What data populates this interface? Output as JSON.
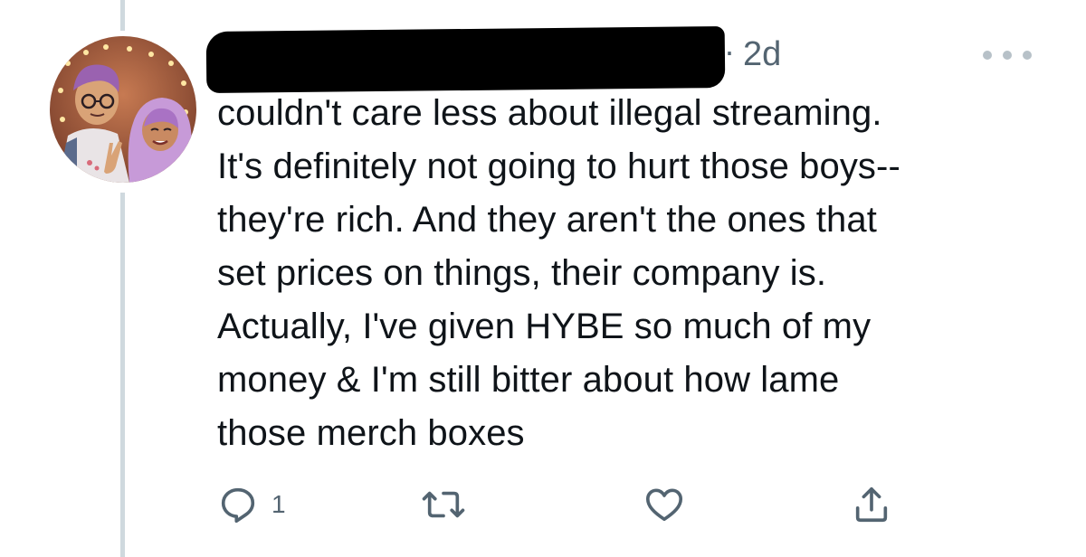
{
  "tweet": {
    "timestamp": "2d",
    "separator": "·",
    "lines": [
      "couldn't care less about illegal streaming.",
      "It's definitely not going to hurt those boys--",
      "they're rich. And they aren't the ones that",
      "set prices on things, their company is.",
      "Actually, I've given HYBE so much of my",
      "money & I'm still bitter about how lame",
      "those merch boxes"
    ]
  },
  "actions": {
    "reply_count": "1",
    "icons": [
      "reply-icon",
      "retweet-icon",
      "like-icon",
      "share-icon"
    ]
  },
  "colors": {
    "text": "#0f1419",
    "secondary": "#536471",
    "thread_line": "#cfd9de"
  }
}
